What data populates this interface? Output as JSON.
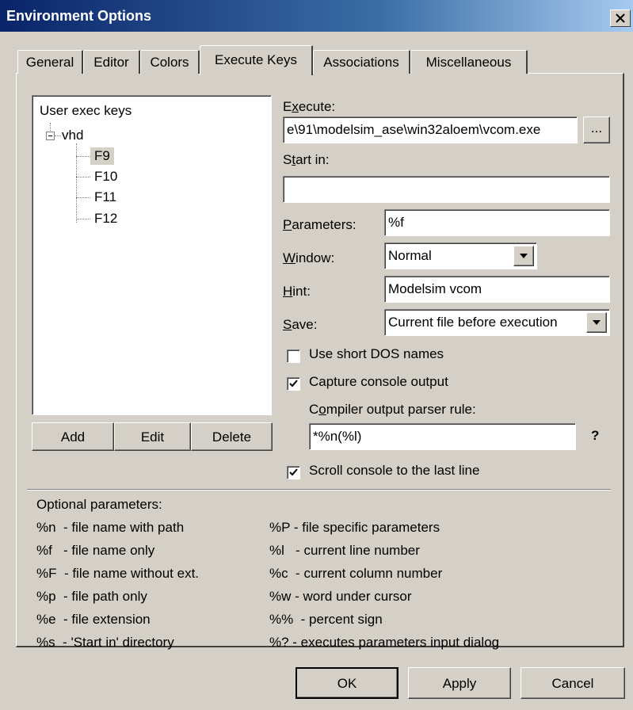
{
  "window": {
    "title": "Environment Options"
  },
  "tabs": [
    {
      "label": "General"
    },
    {
      "label": "Editor"
    },
    {
      "label": "Colors"
    },
    {
      "label": "Execute Keys"
    },
    {
      "label": "Associations"
    },
    {
      "label": "Miscellaneous"
    }
  ],
  "active_tab": "Execute Keys",
  "tree": {
    "root": "User exec keys",
    "group": "vhd",
    "keys": [
      "F9",
      "F10",
      "F11",
      "F12"
    ],
    "selected": "F9"
  },
  "list_buttons": {
    "add": "Add",
    "edit": "Edit",
    "delete": "Delete"
  },
  "execute": {
    "label_pre": "E",
    "label_u": "x",
    "label_post": "ecute:",
    "value": "e\\91\\modelsim_ase\\win32aloem\\vcom.exe",
    "browse": "..."
  },
  "start_in": {
    "label_pre": "S",
    "label_u": "t",
    "label_post": "art in:",
    "value": ""
  },
  "parameters": {
    "label_u": "P",
    "label_post": "arameters:",
    "value": "%f"
  },
  "window_opt": {
    "label_u": "W",
    "label_post": "indow:",
    "value": "Normal"
  },
  "hint": {
    "label_u": "H",
    "label_post": "int:",
    "value": "Modelsim vcom"
  },
  "save": {
    "label_u": "S",
    "label_post": "ave:",
    "value": "Current file before execution"
  },
  "checkboxes": {
    "short_dos": {
      "label": "Use short DOS names",
      "checked": false
    },
    "capture": {
      "label": "Capture console output",
      "checked": true
    },
    "scroll": {
      "label": "Scroll console to the last line",
      "checked": true
    }
  },
  "parser": {
    "label_pre": "C",
    "label_u": "o",
    "label_post": "mpiler output parser rule:",
    "value": "*%n(%l)",
    "help": "?"
  },
  "optional": {
    "heading": "Optional parameters:",
    "left": [
      "%n  - file name with path",
      "%f   - file name only",
      "%F  - file name without ext.",
      "%p  - file path only",
      "%e  - file extension",
      "%s  - 'Start in' directory"
    ],
    "right": [
      "%P - file specific parameters",
      "%l   - current line number",
      "%c  - current column number",
      "%w - word under cursor",
      "%%  - percent sign",
      "%? - executes parameters input dialog"
    ]
  },
  "dialog_buttons": {
    "ok": "OK",
    "apply": "Apply",
    "cancel": "Cancel"
  }
}
